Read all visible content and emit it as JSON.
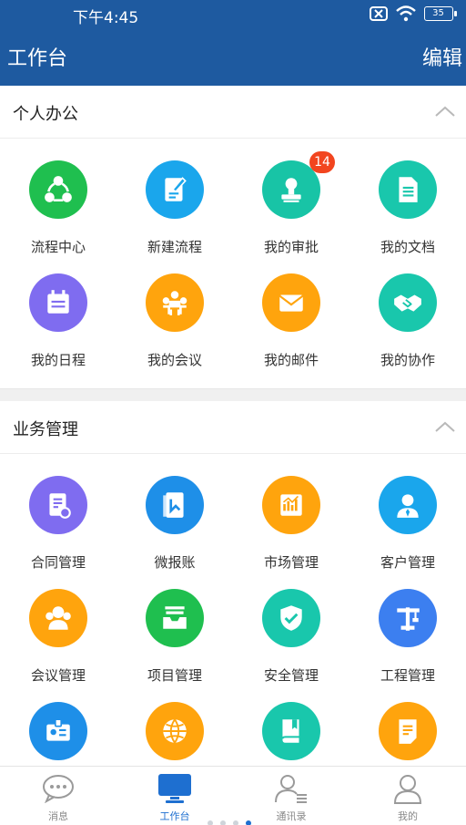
{
  "status": {
    "time": "下午4:45",
    "battery": "35"
  },
  "header": {
    "title": "工作台",
    "edit_label": "编辑"
  },
  "sections": [
    {
      "title": "个人办公",
      "items": [
        {
          "label": "流程中心",
          "icon": "share-nodes-icon",
          "color": "#1fbf4f"
        },
        {
          "label": "新建流程",
          "icon": "edit-document-icon",
          "color": "#1aa6ec"
        },
        {
          "label": "我的审批",
          "icon": "stamp-icon",
          "color": "#18c4a6",
          "badge": "14"
        },
        {
          "label": "我的文档",
          "icon": "document-icon",
          "color": "#19c7ac"
        },
        {
          "label": "我的日程",
          "icon": "calendar-icon",
          "color": "#7f6cf0"
        },
        {
          "label": "我的会议",
          "icon": "meeting-icon",
          "color": "#ffa40d"
        },
        {
          "label": "我的邮件",
          "icon": "mail-icon",
          "color": "#ffa40d"
        },
        {
          "label": "我的协作",
          "icon": "handshake-icon",
          "color": "#19c7ac"
        }
      ]
    },
    {
      "title": "业务管理",
      "items": [
        {
          "label": "合同管理",
          "icon": "contract-icon",
          "color": "#7f6cf0"
        },
        {
          "label": "微报账",
          "icon": "report-book-icon",
          "color": "#1e8fe8"
        },
        {
          "label": "市场管理",
          "icon": "market-chart-icon",
          "color": "#ffa40d"
        },
        {
          "label": "客户管理",
          "icon": "customer-icon",
          "color": "#1aa6ec"
        },
        {
          "label": "会议管理",
          "icon": "people-group-icon",
          "color": "#ffa40d"
        },
        {
          "label": "项目管理",
          "icon": "inbox-tray-icon",
          "color": "#1fbf4f"
        },
        {
          "label": "安全管理",
          "icon": "shield-check-icon",
          "color": "#19c7ac"
        },
        {
          "label": "工程管理",
          "icon": "crane-icon",
          "color": "#3c7ff0"
        },
        {
          "label": "",
          "icon": "id-card-icon",
          "color": "#1e8fe8"
        },
        {
          "label": "",
          "icon": "globe-icon",
          "color": "#ffa40d"
        },
        {
          "label": "",
          "icon": "book-icon",
          "color": "#19c7ac"
        },
        {
          "label": "",
          "icon": "note-icon",
          "color": "#ffa40d"
        }
      ]
    }
  ],
  "tabs": [
    {
      "label": "消息",
      "icon": "message-bubble-icon",
      "active": false
    },
    {
      "label": "工作台",
      "icon": "monitor-icon",
      "active": true
    },
    {
      "label": "通讯录",
      "icon": "contacts-icon",
      "active": false
    },
    {
      "label": "我的",
      "icon": "profile-icon",
      "active": false
    }
  ],
  "colors": {
    "primary": "#1e5aa0",
    "tab_active": "#1e6fd0",
    "badge": "#f2451f"
  }
}
